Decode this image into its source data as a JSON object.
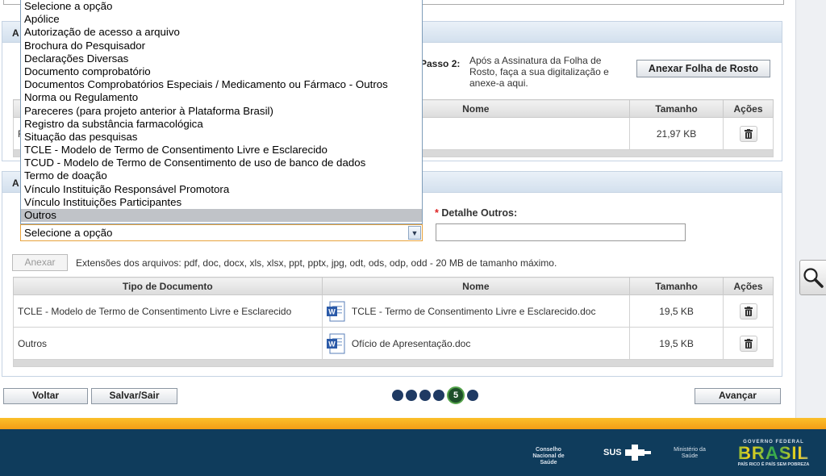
{
  "dropdown": {
    "options": [
      "Selecione a opção",
      "Apólice",
      "Autorização de acesso a arquivo",
      "Brochura do Pesquisador",
      "Declarações Diversas",
      "Documento comprobatório",
      "Documentos Comprobatórios Especiais / Medicamento ou Fármaco - Outros",
      "Norma ou Regulamento",
      "Pareceres (para projeto anterior à Plataforma Brasil)",
      "Registro da substância farmacológica",
      "Situação das pesquisas",
      "TCLE - Modelo de Termo de Consentimento Livre e Esclarecido",
      "TCUD - Modelo de Termo de Consentimento de uso de banco de dados",
      "Termo de doação",
      "Vínculo Instituição Responsável Promotora",
      "Vínculo Instituições Participantes",
      "Outros"
    ],
    "highlighted": "Outros",
    "selected_value": "Selecione a opção"
  },
  "panel1": {
    "title_fragment": "A",
    "passo2_label": "Passo 2:",
    "passo2_text": "Após a Assinatura da Folha de Rosto, faça a sua digitalização e anexe-a aqui.",
    "attach_button": "Anexar Folha de Rosto",
    "table": {
      "headers": [
        "Nome",
        "Tamanho",
        "Ações"
      ],
      "row_fragment": "F",
      "size": "21,97 KB"
    }
  },
  "panel2": {
    "title_fragment": "A",
    "detail_label": "Detalhe Outros:",
    "required_mark": "*",
    "detail_value": "",
    "attach_button": "Anexar",
    "extensions_text": "Extensões dos arquivos: pdf, doc, docx, xls, xlsx, ppt, pptx, jpg, odt, ods, odp, odd - 20 MB de tamanho máximo.",
    "table": {
      "headers": [
        "Tipo de Documento",
        "Nome",
        "Tamanho",
        "Ações"
      ],
      "rows": [
        {
          "type": "TCLE - Modelo de Termo de Consentimento Livre e Esclarecido",
          "name": "TCLE - Termo de Consentimento Livre e Esclarecido.doc",
          "size": "19,5 KB"
        },
        {
          "type": "Outros",
          "name": "Ofício de Apresentação.doc",
          "size": "19,5 KB"
        }
      ]
    }
  },
  "nav": {
    "back": "Voltar",
    "save_exit": "Salvar/Sair",
    "next": "Avançar",
    "current_step": "5",
    "total_steps": 6
  },
  "footer": {
    "logo1": "Conselho Nacional de Saúde",
    "logo2": "SUS",
    "logo3": "Ministério da Saúde",
    "logo4_top": "GOVERNO FEDERAL",
    "logo4_main": "BRASIL",
    "logo4_bottom": "PAÍS RICO É PAÍS SEM POBREZA"
  },
  "colors": {
    "accent_orange": "#f29d16",
    "footer_blue": "#0f3c5c",
    "active_step_green": "#1d4f2a"
  },
  "icons": [
    "trash-icon",
    "word-doc-icon",
    "magnifier-icon",
    "dropdown-arrow-icon"
  ]
}
